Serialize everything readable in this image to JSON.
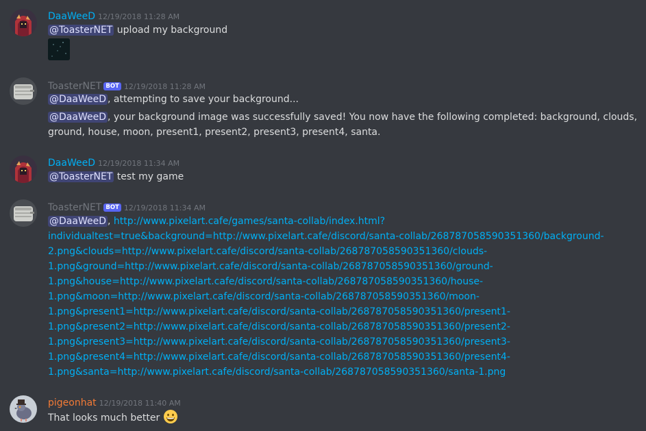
{
  "colors": {
    "daaweed": "#00aff4",
    "toaster": "#72767d",
    "pigeon": "#f47b36",
    "link": "#00aff4",
    "mention": "#5865f2"
  },
  "messages": [
    {
      "username": "DaaWeeD",
      "timestamp": "12/19/2018 11:28 AM",
      "mention": "@ToasterNET",
      "text": " upload my background",
      "attachment_icon": "image-attachment"
    },
    {
      "username": "ToasterNET",
      "badge": "BOT",
      "timestamp": "12/19/2018 11:28 AM",
      "line1_mention": "@DaaWeeD",
      "line1_text": ", attempting to save your background...",
      "line2_mention": "@DaaWeeD",
      "line2_text": ", your background image was successfully saved! You now have the following completed: background, clouds,",
      "line3_text": "ground, house, moon, present1, present2, present3, present4, santa."
    },
    {
      "username": "DaaWeeD",
      "timestamp": "12/19/2018 11:34 AM",
      "mention": "@ToasterNET",
      "text": " test my game"
    },
    {
      "username": "ToasterNET",
      "badge": "BOT",
      "timestamp": "12/19/2018 11:34 AM",
      "mention": "@DaaWeeD",
      "comma": ", ",
      "link_lines": [
        "http://www.pixelart.cafe/games/santa-collab/index.html?",
        "individualtest=true&background=http://www.pixelart.cafe/discord/santa-collab/268787058590351360/background-",
        "2.png&clouds=http://www.pixelart.cafe/discord/santa-collab/268787058590351360/clouds-",
        "1.png&ground=http://www.pixelart.cafe/discord/santa-collab/268787058590351360/ground-",
        "1.png&house=http://www.pixelart.cafe/discord/santa-collab/268787058590351360/house-",
        "1.png&moon=http://www.pixelart.cafe/discord/santa-collab/268787058590351360/moon-",
        "1.png&present1=http://www.pixelart.cafe/discord/santa-collab/268787058590351360/present1-",
        "1.png&present2=http://www.pixelart.cafe/discord/santa-collab/268787058590351360/present2-",
        "1.png&present3=http://www.pixelart.cafe/discord/santa-collab/268787058590351360/present3-",
        "1.png&present4=http://www.pixelart.cafe/discord/santa-collab/268787058590351360/present4-",
        "1.png&santa=http://www.pixelart.cafe/discord/santa-collab/268787058590351360/santa-1.png"
      ]
    },
    {
      "username": "pigeonhat",
      "timestamp": "12/19/2018 11:40 AM",
      "text": "That looks much better ",
      "emoji_icon": "grinning-emoji"
    }
  ]
}
